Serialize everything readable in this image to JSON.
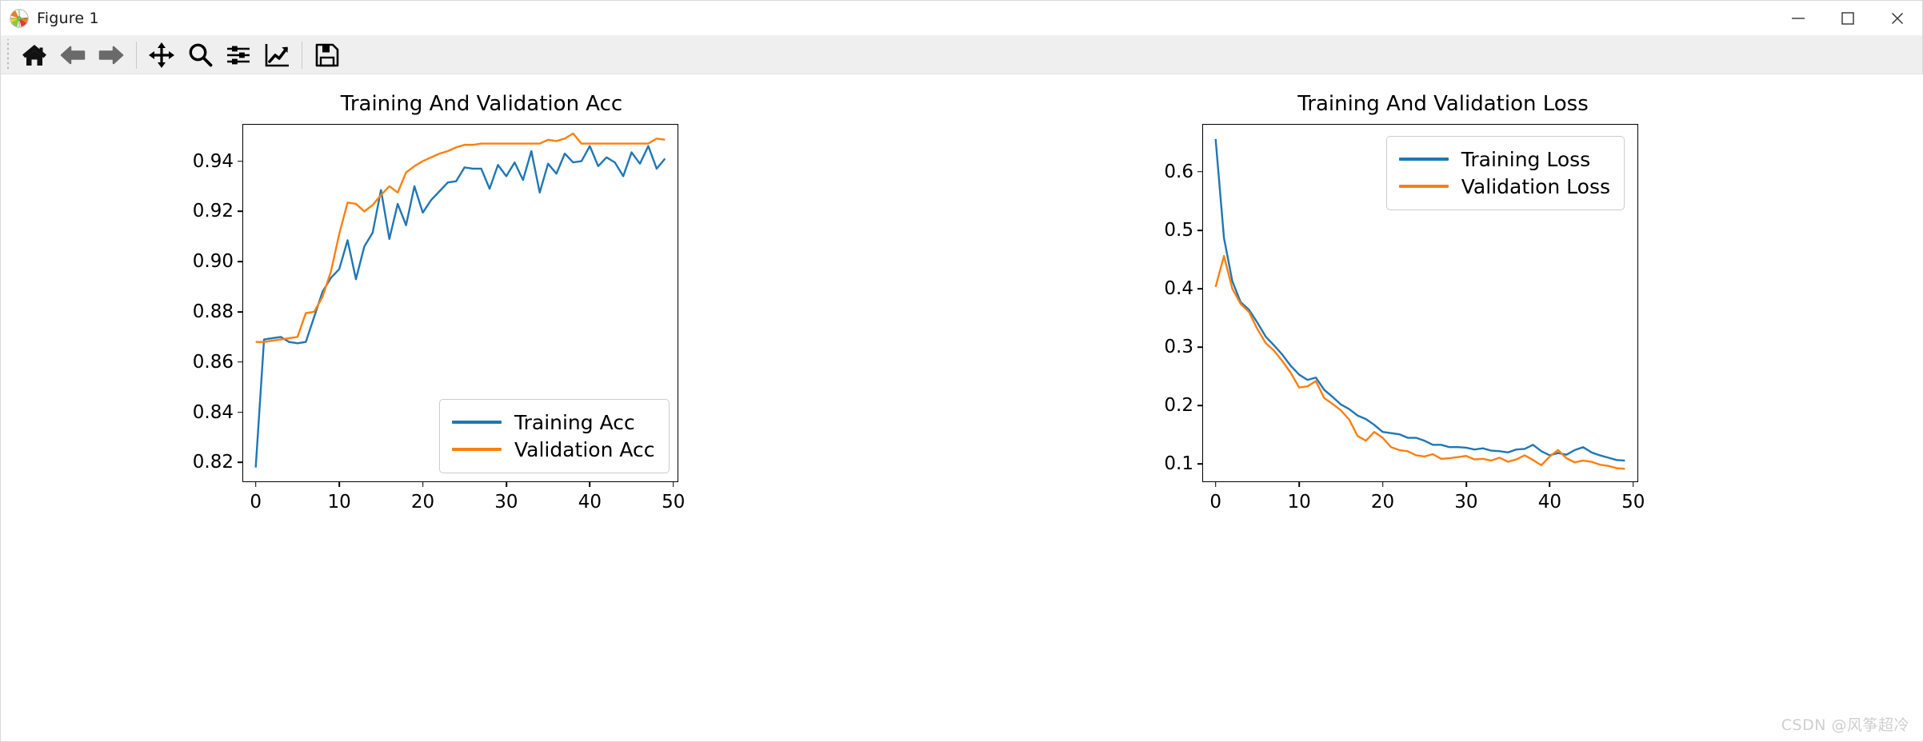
{
  "window": {
    "title": "Figure 1",
    "logo_icon": "matplotlib-logo-icon",
    "minimize_label": "Minimize",
    "maximize_label": "Maximize",
    "close_label": "Close"
  },
  "toolbar": {
    "items": [
      {
        "name": "home-icon",
        "label": "Reset original view",
        "enabled": true
      },
      {
        "name": "back-arrow-icon",
        "label": "Back to previous view",
        "enabled": false
      },
      {
        "name": "forward-arrow-icon",
        "label": "Forward to next view",
        "enabled": false
      },
      {
        "name": "pan-move-icon",
        "label": "Pan axes with left mouse",
        "enabled": true
      },
      {
        "name": "zoom-magnifier-icon",
        "label": "Zoom to rectangle",
        "enabled": true
      },
      {
        "name": "subplot-sliders-icon",
        "label": "Configure subplots",
        "enabled": true
      },
      {
        "name": "chart-curve-icon",
        "label": "Edit axis, curve and image parameters",
        "enabled": true
      },
      {
        "name": "save-floppy-icon",
        "label": "Save the figure",
        "enabled": true
      }
    ]
  },
  "watermark": "CSDN @风筝超冷",
  "chart_data": [
    {
      "type": "line",
      "title": "Training And Validation Acc",
      "xlabel": "",
      "ylabel": "",
      "xlim": [
        -1.5,
        50.5
      ],
      "ylim": [
        0.8125,
        0.9545
      ],
      "xticks": [
        0,
        10,
        20,
        30,
        40,
        50
      ],
      "yticks": [
        0.82,
        0.84,
        0.86,
        0.88,
        0.9,
        0.92,
        0.94
      ],
      "ytick_labels": [
        "0.82",
        "0.84",
        "0.86",
        "0.88",
        "0.90",
        "0.92",
        "0.94"
      ],
      "xtick_labels": [
        "0",
        "10",
        "20",
        "30",
        "40",
        "50"
      ],
      "grid": false,
      "legend_position": "lower right",
      "x": [
        0,
        1,
        2,
        3,
        4,
        5,
        6,
        7,
        8,
        9,
        10,
        11,
        12,
        13,
        14,
        15,
        16,
        17,
        18,
        19,
        20,
        21,
        22,
        23,
        24,
        25,
        26,
        27,
        28,
        29,
        30,
        31,
        32,
        33,
        34,
        35,
        36,
        37,
        38,
        39,
        40,
        41,
        42,
        43,
        44,
        45,
        46,
        47,
        48,
        49
      ],
      "series": [
        {
          "name": "Training Acc",
          "color": "#1f77b4",
          "values": [
            0.818,
            0.869,
            0.8695,
            0.87,
            0.868,
            0.8675,
            0.868,
            0.878,
            0.888,
            0.8935,
            0.897,
            0.9085,
            0.893,
            0.906,
            0.9115,
            0.9285,
            0.909,
            0.923,
            0.9145,
            0.93,
            0.9195,
            0.9245,
            0.928,
            0.9315,
            0.932,
            0.9375,
            0.937,
            0.937,
            0.929,
            0.9385,
            0.934,
            0.9395,
            0.9325,
            0.944,
            0.9275,
            0.939,
            0.935,
            0.943,
            0.9395,
            0.94,
            0.946,
            0.938,
            0.9415,
            0.9395,
            0.934,
            0.9435,
            0.939,
            0.946,
            0.937,
            0.941
          ]
        },
        {
          "name": "Validation Acc",
          "color": "#ff7f0e",
          "values": [
            0.868,
            0.868,
            0.8685,
            0.869,
            0.8695,
            0.87,
            0.8795,
            0.88,
            0.886,
            0.896,
            0.911,
            0.9235,
            0.923,
            0.92,
            0.9225,
            0.9265,
            0.93,
            0.9275,
            0.9355,
            0.938,
            0.94,
            0.9415,
            0.943,
            0.944,
            0.9455,
            0.9465,
            0.9465,
            0.947,
            0.947,
            0.947,
            0.947,
            0.947,
            0.947,
            0.947,
            0.947,
            0.9485,
            0.948,
            0.949,
            0.951,
            0.947,
            0.947,
            0.947,
            0.947,
            0.947,
            0.947,
            0.947,
            0.947,
            0.947,
            0.949,
            0.9485
          ]
        }
      ]
    },
    {
      "type": "line",
      "title": "Training And Validation Loss",
      "xlabel": "",
      "ylabel": "",
      "xlim": [
        -1.5,
        50.5
      ],
      "ylim": [
        0.0705,
        0.6805
      ],
      "xticks": [
        0,
        10,
        20,
        30,
        40,
        50
      ],
      "yticks": [
        0.1,
        0.2,
        0.3,
        0.4,
        0.5,
        0.6
      ],
      "ytick_labels": [
        "0.1",
        "0.2",
        "0.3",
        "0.4",
        "0.5",
        "0.6"
      ],
      "xtick_labels": [
        "0",
        "10",
        "20",
        "30",
        "40",
        "50"
      ],
      "grid": false,
      "legend_position": "upper right",
      "x": [
        0,
        1,
        2,
        3,
        4,
        5,
        6,
        7,
        8,
        9,
        10,
        11,
        12,
        13,
        14,
        15,
        16,
        17,
        18,
        19,
        20,
        21,
        22,
        23,
        24,
        25,
        26,
        27,
        28,
        29,
        30,
        31,
        32,
        33,
        34,
        35,
        36,
        37,
        38,
        39,
        40,
        41,
        42,
        43,
        44,
        45,
        46,
        47,
        48,
        49
      ],
      "series": [
        {
          "name": "Training Loss",
          "color": "#1f77b4",
          "values": [
            0.656,
            0.487,
            0.413,
            0.377,
            0.364,
            0.342,
            0.318,
            0.303,
            0.287,
            0.268,
            0.253,
            0.244,
            0.248,
            0.227,
            0.215,
            0.202,
            0.194,
            0.183,
            0.177,
            0.167,
            0.155,
            0.153,
            0.151,
            0.145,
            0.145,
            0.14,
            0.133,
            0.133,
            0.129,
            0.129,
            0.128,
            0.125,
            0.127,
            0.123,
            0.122,
            0.12,
            0.125,
            0.126,
            0.133,
            0.122,
            0.115,
            0.119,
            0.116,
            0.124,
            0.129,
            0.12,
            0.115,
            0.111,
            0.107,
            0.106
          ]
        },
        {
          "name": "Validation Loss",
          "color": "#ff7f0e",
          "values": [
            0.403,
            0.456,
            0.4,
            0.374,
            0.36,
            0.331,
            0.307,
            0.294,
            0.276,
            0.256,
            0.231,
            0.233,
            0.242,
            0.213,
            0.203,
            0.192,
            0.176,
            0.148,
            0.14,
            0.155,
            0.145,
            0.129,
            0.124,
            0.122,
            0.115,
            0.113,
            0.117,
            0.109,
            0.11,
            0.112,
            0.114,
            0.108,
            0.109,
            0.106,
            0.111,
            0.104,
            0.108,
            0.115,
            0.107,
            0.098,
            0.113,
            0.124,
            0.11,
            0.103,
            0.106,
            0.104,
            0.099,
            0.097,
            0.093,
            0.092
          ]
        }
      ]
    }
  ]
}
